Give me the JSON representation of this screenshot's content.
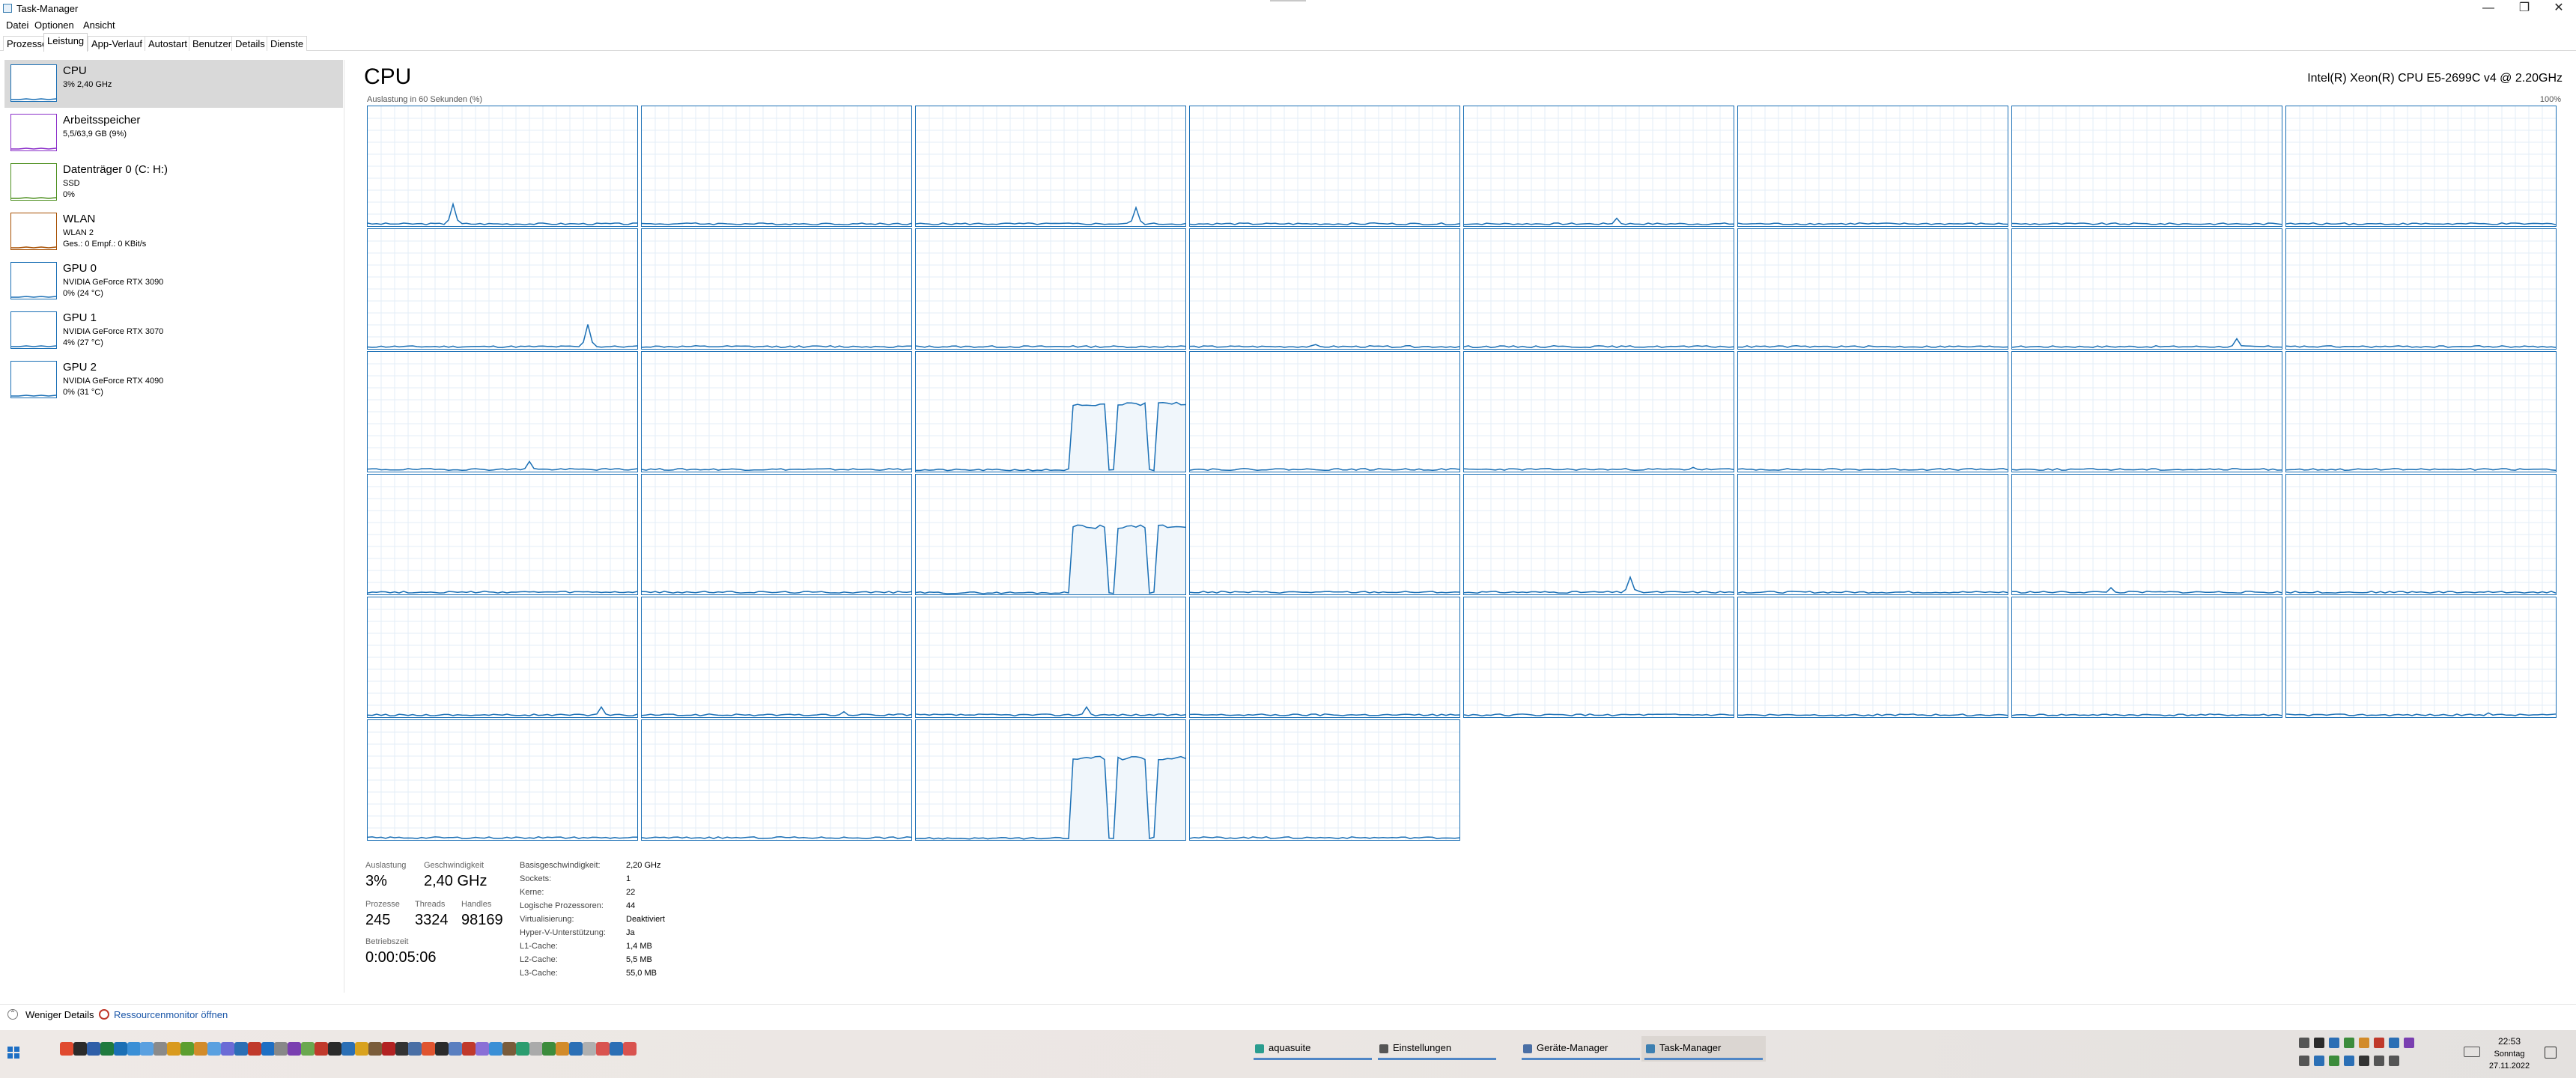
{
  "window": {
    "title": "Task-Manager",
    "minimize_icon": "minimize-icon",
    "maximize_icon": "restore-icon",
    "close_icon": "close-icon"
  },
  "menu": [
    "Datei",
    "Optionen",
    "Ansicht"
  ],
  "tabs": [
    "Prozesse",
    "Leistung",
    "App-Verlauf",
    "Autostart",
    "Benutzer",
    "Details",
    "Dienste"
  ],
  "active_tab": "Leistung",
  "sidebar": {
    "items": [
      {
        "name": "CPU",
        "lines": [
          "3% 2,40 GHz"
        ],
        "color": "#1a6fb5",
        "selected": true
      },
      {
        "name": "Arbeitsspeicher",
        "lines": [
          "5,5/63,9 GB (9%)"
        ],
        "color": "#8b2fc9",
        "selected": false
      },
      {
        "name": "Datenträger 0 (C: H:)",
        "lines": [
          "SSD",
          "0%"
        ],
        "color": "#4d8f1f",
        "selected": false
      },
      {
        "name": "WLAN",
        "lines": [
          "WLAN 2",
          "Ges.: 0 Empf.: 0 KBit/s"
        ],
        "color": "#a74f01",
        "selected": false
      },
      {
        "name": "GPU 0",
        "lines": [
          "NVIDIA GeForce RTX 3090",
          "0% (24 °C)"
        ],
        "color": "#1a6fb5",
        "selected": false
      },
      {
        "name": "GPU 1",
        "lines": [
          "NVIDIA GeForce RTX 3070",
          "4% (27 °C)"
        ],
        "color": "#1a6fb5",
        "selected": false
      },
      {
        "name": "GPU 2",
        "lines": [
          "NVIDIA GeForce RTX 4090",
          "0% (31 °C)"
        ],
        "color": "#1a6fb5",
        "selected": false
      }
    ]
  },
  "main": {
    "title": "CPU",
    "model": "Intel(R) Xeon(R) CPU E5-2699C v4 @ 2.20GHz",
    "graph_caption": "Auslastung in 60 Sekunden (%)",
    "graph_max": "100%",
    "core_count": 44,
    "core_peaks_percent": [
      18,
      2,
      15,
      2,
      6,
      2,
      2,
      2,
      20,
      2,
      2,
      3,
      2,
      2,
      8,
      2,
      8,
      1,
      58,
      1,
      3,
      1,
      1,
      1,
      1,
      1,
      58,
      1,
      14,
      1,
      5,
      1,
      8,
      4,
      8,
      2,
      1,
      1,
      1,
      3,
      2,
      2,
      70,
      2
    ]
  },
  "stats": {
    "auslastung_label": "Auslastung",
    "auslastung": "3%",
    "geschwindigkeit_label": "Geschwindigkeit",
    "geschwindigkeit": "2,40 GHz",
    "prozesse_label": "Prozesse",
    "prozesse": "245",
    "threads_label": "Threads",
    "threads": "3324",
    "handles_label": "Handles",
    "handles": "98169",
    "betriebszeit_label": "Betriebszeit",
    "betriebszeit": "0:00:05:06",
    "details": [
      {
        "label": "Basisgeschwindigkeit:",
        "value": "2,20 GHz"
      },
      {
        "label": "Sockets:",
        "value": "1"
      },
      {
        "label": "Kerne:",
        "value": "22"
      },
      {
        "label": "Logische Prozessoren:",
        "value": "44"
      },
      {
        "label": "Virtualisierung:",
        "value": "Deaktiviert"
      },
      {
        "label": "Hyper-V-Unterstützung:",
        "value": "Ja"
      },
      {
        "label": "L1-Cache:",
        "value": "1,4 MB"
      },
      {
        "label": "L2-Cache:",
        "value": "5,5 MB"
      },
      {
        "label": "L3-Cache:",
        "value": "55,0 MB"
      }
    ]
  },
  "footer": {
    "less_details": "Weniger Details",
    "resource_monitor": "Ressourcenmonitor öffnen"
  },
  "taskbar": {
    "apps": [
      {
        "label": "aquasuite",
        "color": "#2a9d8f",
        "active": false
      },
      {
        "label": "Einstellungen",
        "color": "#555555",
        "active": false
      },
      {
        "label": "Geräte-Manager",
        "color": "#4a6fa5",
        "active": false
      },
      {
        "label": "Task-Manager",
        "color": "#3c7fb1",
        "active": true
      }
    ],
    "time": "22:53",
    "day": "Sonntag",
    "date": "27.11.2022"
  }
}
